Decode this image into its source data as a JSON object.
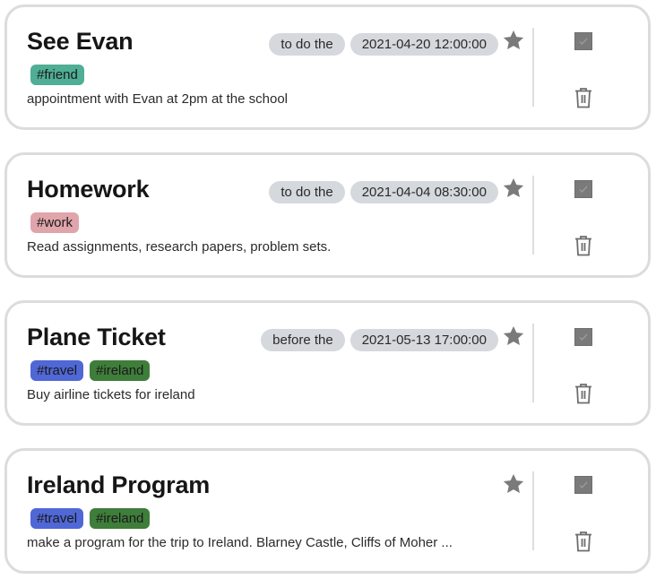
{
  "colors": {
    "pill_bg": "#d5d8dd",
    "star": "#7a7a7a",
    "icon": "#7a7a7a",
    "card_border": "#dcdcdc"
  },
  "icons": {
    "favorite": "star-icon",
    "complete": "checkbox-icon",
    "delete": "trash-icon"
  },
  "tasks": [
    {
      "title": "See Evan",
      "qualifier": "to do the",
      "datetime": "2021-04-20 12:00:00",
      "tags": [
        {
          "label": "#friend",
          "color": "#4fae95"
        }
      ],
      "description": "appointment with Evan at 2pm at the school",
      "has_date": true
    },
    {
      "title": "Homework",
      "qualifier": "to do the",
      "datetime": "2021-04-04 08:30:00",
      "tags": [
        {
          "label": "#work",
          "color": "#e0a5ab"
        }
      ],
      "description": "Read assignments, research papers, problem sets.",
      "has_date": true
    },
    {
      "title": "Plane Ticket",
      "qualifier": "before the",
      "datetime": "2021-05-13 17:00:00",
      "tags": [
        {
          "label": "#travel",
          "color": "#5067d6"
        },
        {
          "label": "#ireland",
          "color": "#3f7d3a"
        }
      ],
      "description": "Buy airline tickets for ireland",
      "has_date": true
    },
    {
      "title": "Ireland Program",
      "qualifier": "",
      "datetime": "",
      "tags": [
        {
          "label": "#travel",
          "color": "#5067d6"
        },
        {
          "label": "#ireland",
          "color": "#3f7d3a"
        }
      ],
      "description": "make a program for the trip to Ireland. Blarney Castle, Cliffs of Moher ...",
      "has_date": false
    }
  ]
}
